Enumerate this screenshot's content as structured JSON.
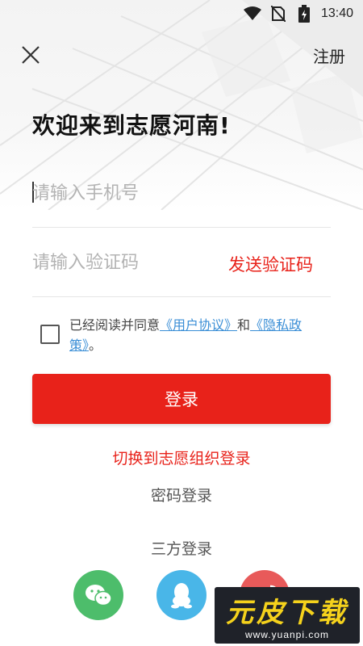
{
  "status_bar": {
    "time": "13:40",
    "icons": [
      "wifi-icon",
      "no-sim-icon",
      "battery-icon"
    ]
  },
  "header": {
    "close_icon": "close-icon",
    "register_label": "注册"
  },
  "welcome_title": "欢迎来到志愿河南!",
  "phone_input": {
    "placeholder": "请输入手机号",
    "value": ""
  },
  "code_input": {
    "placeholder": "请输入验证码",
    "value": "",
    "send_code_label": "发送验证码"
  },
  "agreement": {
    "checked": false,
    "prefix": "已经阅读并同意",
    "user_agreement": "《用户协议》",
    "and": "和",
    "privacy_policy": "《隐私政策》",
    "suffix": "。"
  },
  "login_button_label": "登录",
  "switch_org_label": "切换到志愿组织登录",
  "password_login_label": "密码登录",
  "third_party": {
    "title": "三方登录",
    "options": [
      "wechat-icon",
      "qq-icon",
      "weibo-icon"
    ]
  },
  "watermark": {
    "text": "元皮下载",
    "url": "www.yuanpi.com"
  },
  "colors": {
    "accent_red": "#e8221a",
    "link_blue": "#3a8ed6",
    "wechat_green": "#4dbd6b",
    "qq_blue": "#49b6e8",
    "weibo_red": "#e85a5a"
  }
}
